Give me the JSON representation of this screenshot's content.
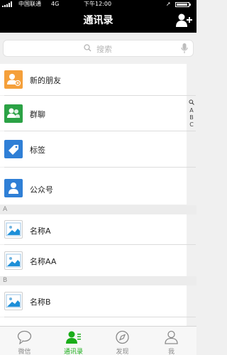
{
  "status_bar": {
    "carrier": "中国联通",
    "network": "4G",
    "time": "下午12:00"
  },
  "nav": {
    "title": "通讯录"
  },
  "search": {
    "placeholder": "搜索"
  },
  "fixed_items": [
    {
      "label": "新的朋友",
      "icon": "new-friend-icon",
      "color": "#f5a03b"
    },
    {
      "label": "群聊",
      "icon": "group-chat-icon",
      "color": "#2ba245"
    },
    {
      "label": "标签",
      "icon": "tag-icon",
      "color": "#2f7fd6"
    },
    {
      "label": "公众号",
      "icon": "official-account-icon",
      "color": "#2f7fd6"
    }
  ],
  "index_bar": [
    "A",
    "B",
    "C"
  ],
  "sections": [
    {
      "letter": "A",
      "contacts": [
        "名称A",
        "名称AA"
      ]
    },
    {
      "letter": "B",
      "contacts": [
        "名称B"
      ]
    }
  ],
  "tabs": [
    {
      "label": "微信",
      "icon": "chat-bubble-icon",
      "active": false
    },
    {
      "label": "通讯录",
      "icon": "contacts-icon",
      "active": true
    },
    {
      "label": "发现",
      "icon": "compass-icon",
      "active": false
    },
    {
      "label": "我",
      "icon": "person-icon",
      "active": false
    }
  ],
  "colors": {
    "accent": "#1aad19",
    "nav_bg": "#000000",
    "inactive": "#8a8a8a"
  }
}
